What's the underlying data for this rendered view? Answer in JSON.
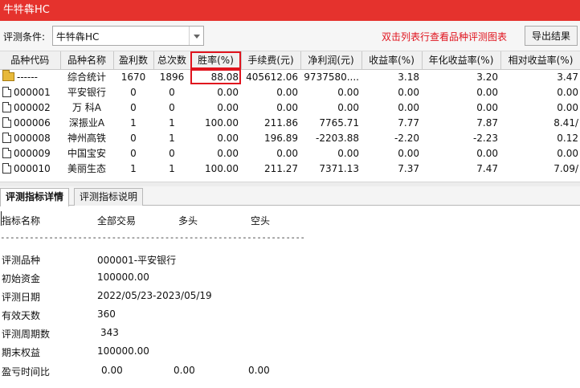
{
  "window": {
    "title": "牛牪犇HC"
  },
  "condition": {
    "label": "评测条件:",
    "value": "牛牪犇HC"
  },
  "hint": "双击列表行查看品种评测图表",
  "export_label": "导出结果",
  "table": {
    "columns": [
      "品种代码",
      "品种名称",
      "盈利数",
      "总次数",
      "胜率(%)",
      "手续费(元)",
      "净利润(元)",
      "收益率(%)",
      "年化收益率(%)",
      "相对收益率(%)"
    ],
    "rows": [
      {
        "code": "------",
        "name": "综合统计",
        "win": "1670",
        "total": "1896",
        "rate": "88.08",
        "fee": "405612.06",
        "profit": "9737580....",
        "ret": "3.18",
        "annual": "3.20",
        "rel": "3.47"
      },
      {
        "code": "000001",
        "name": "平安银行",
        "win": "0",
        "total": "0",
        "rate": "0.00",
        "fee": "0.00",
        "profit": "0.00",
        "ret": "0.00",
        "annual": "0.00",
        "rel": "0.00"
      },
      {
        "code": "000002",
        "name": "万 科A",
        "win": "0",
        "total": "0",
        "rate": "0.00",
        "fee": "0.00",
        "profit": "0.00",
        "ret": "0.00",
        "annual": "0.00",
        "rel": "0.00"
      },
      {
        "code": "000006",
        "name": "深振业A",
        "win": "1",
        "total": "1",
        "rate": "100.00",
        "fee": "211.86",
        "profit": "7765.71",
        "ret": "7.77",
        "annual": "7.87",
        "rel": "8.41/"
      },
      {
        "code": "000008",
        "name": "神州高铁",
        "win": "0",
        "total": "1",
        "rate": "0.00",
        "fee": "196.89",
        "profit": "-2203.88",
        "ret": "-2.20",
        "annual": "-2.23",
        "rel": "0.12"
      },
      {
        "code": "000009",
        "name": "中国宝安",
        "win": "0",
        "total": "0",
        "rate": "0.00",
        "fee": "0.00",
        "profit": "0.00",
        "ret": "0.00",
        "annual": "0.00",
        "rel": "0.00"
      },
      {
        "code": "000010",
        "name": "美丽生态",
        "win": "1",
        "total": "1",
        "rate": "100.00",
        "fee": "211.27",
        "profit": "7371.13",
        "ret": "7.37",
        "annual": "7.47",
        "rel": "7.09/"
      }
    ]
  },
  "tabs": [
    "评测指标详情",
    "评测指标说明"
  ],
  "detail": {
    "headers": [
      "指标名称",
      "全部交易",
      "多头",
      "空头"
    ],
    "separator": "----------------------------------------------------------------",
    "rows": [
      {
        "label": "评测品种",
        "value": "000001-平安银行"
      },
      {
        "label": "初始资金",
        "value": "100000.00"
      },
      {
        "label": "评测日期",
        "value": "2022/05/23-2023/05/19"
      },
      {
        "label": "有效天数",
        "value": "360"
      },
      {
        "label": "评测周期数",
        "value": "343"
      },
      {
        "label": "期末权益",
        "value": "100000.00"
      },
      {
        "label": "盈亏时间比",
        "value": "0.00",
        "long": "0.00",
        "short": "0.00"
      }
    ]
  }
}
